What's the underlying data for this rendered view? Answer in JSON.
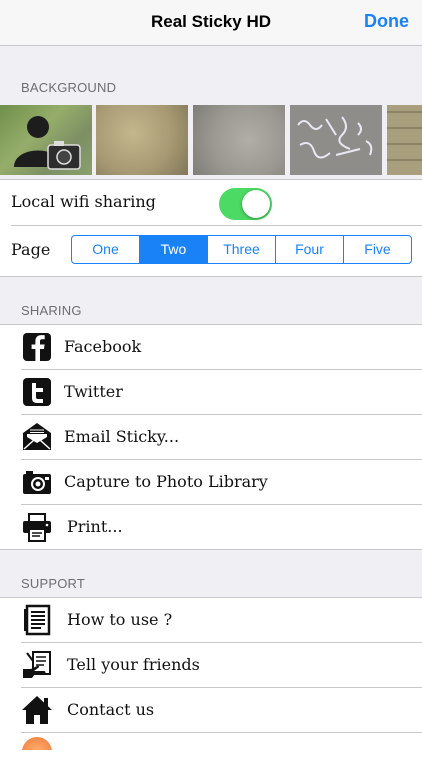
{
  "nav": {
    "title": "Real Sticky HD",
    "done_label": "Done"
  },
  "background_section": {
    "header": "BACKGROUND",
    "thumbnails": [
      "avatar-camera-icon",
      "parchment-texture",
      "concrete-texture",
      "chalk-graffiti-texture",
      "brick-wall-texture"
    ]
  },
  "settings": {
    "wifi_label": "Local wifi sharing",
    "wifi_on": true,
    "page_label": "Page",
    "pages": [
      "One",
      "Two",
      "Three",
      "Four",
      "Five"
    ],
    "selected_page": "Two"
  },
  "sharing": {
    "header": "SHARING",
    "items": [
      {
        "label": "Facebook",
        "icon": "facebook-icon"
      },
      {
        "label": "Twitter",
        "icon": "twitter-icon"
      },
      {
        "label": "Email Sticky...",
        "icon": "envelope-icon"
      },
      {
        "label": "Capture to Photo Library",
        "icon": "camera-icon"
      },
      {
        "label": "Print...",
        "icon": "printer-icon"
      }
    ]
  },
  "support": {
    "header": "SUPPORT",
    "items": [
      {
        "label": "How to use ?",
        "icon": "document-icon"
      },
      {
        "label": "Tell your friends",
        "icon": "hand-note-icon"
      },
      {
        "label": "Contact us",
        "icon": "home-icon"
      }
    ]
  },
  "colors": {
    "accent": "#1a82f7",
    "toggle_on": "#4cd964",
    "group_bg": "#efeff4"
  }
}
